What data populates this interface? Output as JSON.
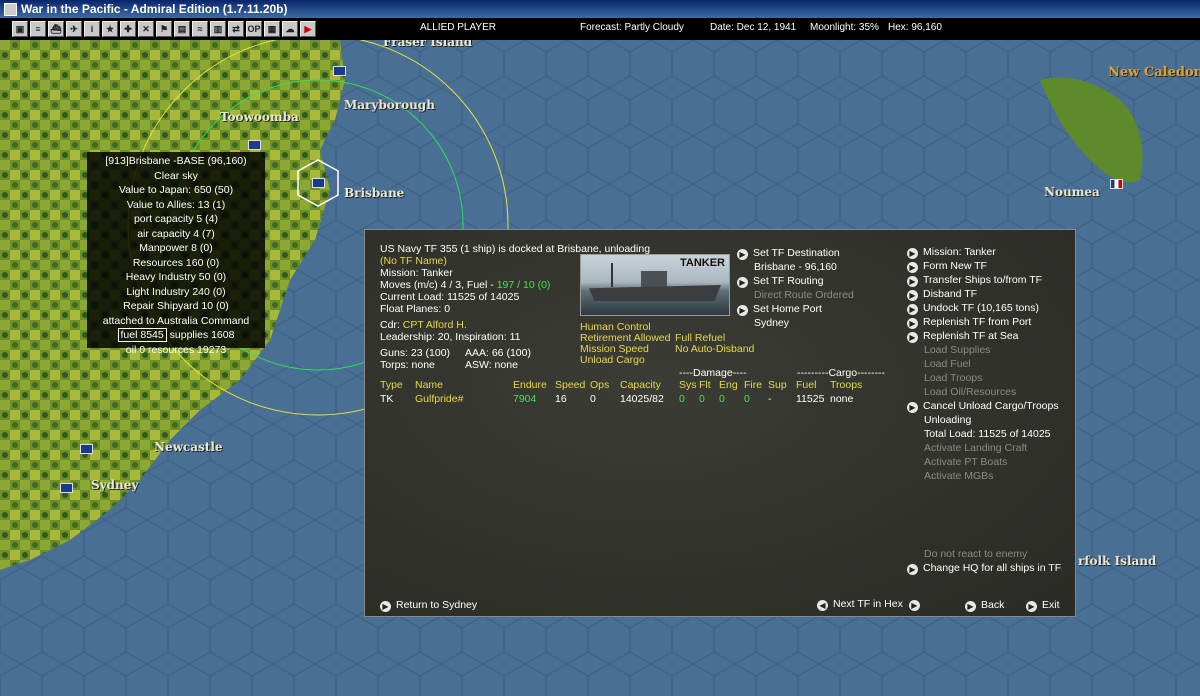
{
  "window": {
    "title": "War in the Pacific - Admiral Edition (1.7.11.20b)"
  },
  "toolbar": {
    "buttons": [
      "ports-icon",
      "list-icon",
      "ship-icon",
      "air-icon",
      "info-icon",
      "star-icon",
      "plane-icon",
      "cross-icon",
      "flag-icon",
      "cargo-icon",
      "wave-icon",
      "factory-icon",
      "transfer-icon",
      "op-icon",
      "report-icon",
      "weather-icon",
      "turn-icon"
    ],
    "player": "ALLIED PLAYER",
    "forecast": "Forecast: Partly Cloudy",
    "date": "Date: Dec 12, 1941",
    "moonlight": "Moonlight: 35%",
    "hex": "Hex: 96,160"
  },
  "map": {
    "cities": [
      {
        "name": "Fraser Island"
      },
      {
        "name": "Maryborough"
      },
      {
        "name": "Toowoomba"
      },
      {
        "name": "Brisbane"
      },
      {
        "name": "Newcastle"
      },
      {
        "name": "Sydney"
      },
      {
        "name": "New Caledon"
      },
      {
        "name": "Noumea"
      },
      {
        "name": "rfolk Island"
      }
    ]
  },
  "base": {
    "lines": [
      "[913]Brisbane -BASE (96,160)",
      "Clear sky",
      "Value to Japan: 650 (50)",
      "Value to Allies: 13 (1)",
      "port capacity 5 (4)",
      "air capacity 4 (7)",
      "Manpower  8 (0)",
      "Resources  160 (0)",
      "Heavy Industry  50 (0)",
      "Light Industry  240 (0)",
      "Repair Shipyard  10 (0)",
      "attached to Australia Command"
    ],
    "fuel": "fuel 8545",
    "supplies": "supplies 1608",
    "last": "oil 0  resources 19273"
  },
  "tf": {
    "header": "US Navy TF 355 (1 ship) is docked at Brisbane, unloading",
    "name": "(No TF Name)",
    "mission": "Mission: Tanker",
    "moves": "Moves (m/c) 4 / 3, Fuel - ",
    "fuel_val": "197 / 10 (0)",
    "load": "Current Load: 11525 of 14025",
    "float": "Float Planes: 0",
    "cdr_label": "Cdr:",
    "cdr": "CPT Alford H.",
    "leadership": "Leadership: 20, Inspiration: 11",
    "guns": "Guns: 23 (100)",
    "aaa": "AAA: 66 (100)",
    "torps": "Torps: none",
    "asw": "ASW: none",
    "image_label": "TANKER",
    "flags_left": [
      "Human Control",
      "Retirement Allowed",
      "Mission Speed",
      "Unload Cargo"
    ],
    "flags_right": [
      "Full Refuel",
      "No Auto-Disband"
    ],
    "dest_actions": [
      "Set TF Destination",
      "Brisbane - 96,160",
      "Direct Route Ordered",
      "Set TF Routing",
      "Set Home Port",
      "Sydney"
    ],
    "table": {
      "damage_header": "----Damage----",
      "cargo_header": "---------Cargo--------",
      "columns": [
        "Type",
        "Name",
        "Endure",
        "Speed",
        "Ops",
        "Capacity",
        "Sys",
        "Flt",
        "Eng",
        "Fire",
        "Sup",
        "Fuel",
        "Troops"
      ],
      "row": [
        "TK",
        "Gulfpride#",
        "7904",
        "16",
        "0",
        "14025/82",
        "0",
        "0",
        "0",
        "0",
        "-",
        "11525",
        "none"
      ]
    },
    "menu": [
      {
        "label": "Mission: Tanker",
        "active": true,
        "arrow": true
      },
      {
        "label": "Form New TF",
        "active": true,
        "arrow": true
      },
      {
        "label": "Transfer Ships to/from TF",
        "active": true,
        "arrow": true
      },
      {
        "label": "Disband TF",
        "active": true,
        "arrow": true
      },
      {
        "label": "Undock TF (10,165 tons)",
        "active": true,
        "arrow": true
      },
      {
        "label": "Replenish TF from Port",
        "active": true,
        "arrow": true
      },
      {
        "label": "Replenish TF at Sea",
        "active": true,
        "arrow": true
      },
      {
        "label": "Load Supplies",
        "active": false,
        "arrow": false
      },
      {
        "label": "Load Fuel",
        "active": false,
        "arrow": false
      },
      {
        "label": "Load Troops",
        "active": false,
        "arrow": false
      },
      {
        "label": "Load Oil/Resources",
        "active": false,
        "arrow": false
      },
      {
        "label": "Cancel Unload Cargo/Troops",
        "active": true,
        "arrow": true
      },
      {
        "label": "Unloading",
        "active": true,
        "arrow": false
      },
      {
        "label": "Total Load: 11525 of 14025",
        "active": true,
        "arrow": false
      },
      {
        "label": "Activate Landing Craft",
        "active": false,
        "arrow": false
      },
      {
        "label": "Activate PT Boats",
        "active": false,
        "arrow": false
      },
      {
        "label": "Activate MGBs",
        "active": false,
        "arrow": false
      }
    ],
    "menu_bottom": [
      {
        "label": "Do not react to enemy",
        "active": false,
        "arrow": false
      },
      {
        "label": "Change HQ for all ships in TF",
        "active": true,
        "arrow": true
      }
    ],
    "footer": {
      "return": "Return to Sydney",
      "next": "Next TF in Hex",
      "back": "Back",
      "exit": "Exit"
    }
  }
}
